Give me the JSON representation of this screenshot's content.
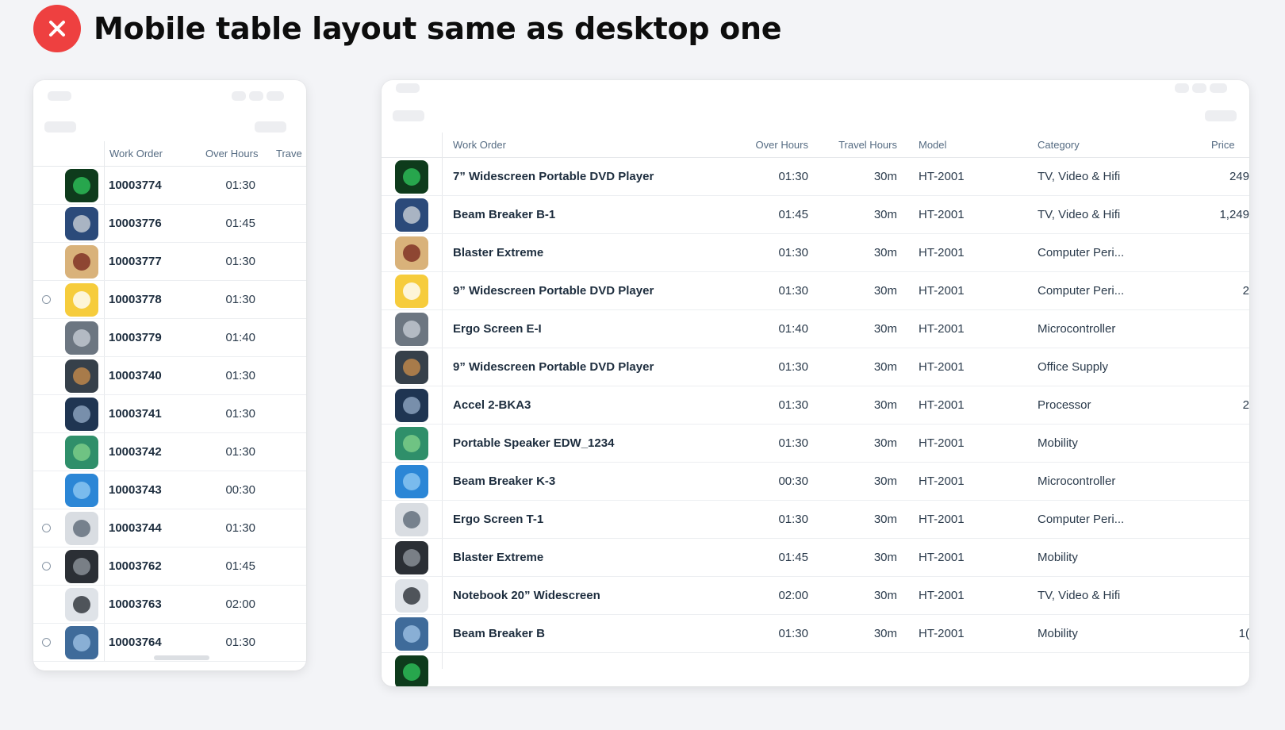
{
  "heading": {
    "title": "Mobile table layout same as desktop one",
    "badge_color": "#ee4040"
  },
  "mobile": {
    "columns": {
      "work_order": "Work Order",
      "over_hours": "Over Hours",
      "travel": "Trave"
    },
    "rows": [
      {
        "id": "10003774",
        "over": "01:30",
        "radio": false,
        "thumb": "matrix"
      },
      {
        "id": "10003776",
        "over": "01:45",
        "radio": false,
        "thumb": "disc"
      },
      {
        "id": "10003777",
        "over": "01:30",
        "radio": false,
        "thumb": "cup"
      },
      {
        "id": "10003778",
        "over": "01:30",
        "radio": true,
        "thumb": "yellow"
      },
      {
        "id": "10003779",
        "over": "01:40",
        "radio": false,
        "thumb": "grey"
      },
      {
        "id": "10003740",
        "over": "01:30",
        "radio": false,
        "thumb": "dark"
      },
      {
        "id": "10003741",
        "over": "01:30",
        "radio": false,
        "thumb": "machine"
      },
      {
        "id": "10003742",
        "over": "01:30",
        "radio": false,
        "thumb": "green"
      },
      {
        "id": "10003743",
        "over": "00:30",
        "radio": false,
        "thumb": "blue"
      },
      {
        "id": "10003744",
        "over": "01:30",
        "radio": true,
        "thumb": "server"
      },
      {
        "id": "10003762",
        "over": "01:45",
        "radio": true,
        "thumb": "fan"
      },
      {
        "id": "10003763",
        "over": "02:00",
        "radio": false,
        "thumb": "tool"
      },
      {
        "id": "10003764",
        "over": "01:30",
        "radio": true,
        "thumb": "city"
      }
    ]
  },
  "desktop": {
    "columns": {
      "work_order": "Work Order",
      "over_hours": "Over Hours",
      "travel_hours": "Travel Hours",
      "model": "Model",
      "category": "Category",
      "price": "Price"
    },
    "rows": [
      {
        "name": "7” Widescreen Portable DVD Player",
        "over": "01:30",
        "travel": "30m",
        "model": "HT-2001",
        "category": "TV, Video & Hifi",
        "price": "249",
        "thumb": "matrix"
      },
      {
        "name": "Beam Breaker B-1",
        "over": "01:45",
        "travel": "30m",
        "model": "HT-2001",
        "category": "TV, Video & Hifi",
        "price": "1,249",
        "thumb": "disc"
      },
      {
        "name": "Blaster Extreme",
        "over": "01:30",
        "travel": "30m",
        "model": "HT-2001",
        "category": "Computer Peri...",
        "price": "",
        "thumb": "cup"
      },
      {
        "name": "9” Widescreen Portable DVD Player",
        "over": "01:30",
        "travel": "30m",
        "model": "HT-2001",
        "category": "Computer Peri...",
        "price": "2",
        "thumb": "yellow"
      },
      {
        "name": "Ergo Screen E-I",
        "over": "01:40",
        "travel": "30m",
        "model": "HT-2001",
        "category": "Microcontroller",
        "price": "",
        "thumb": "grey"
      },
      {
        "name": "9” Widescreen Portable DVD Player",
        "over": "01:30",
        "travel": "30m",
        "model": "HT-2001",
        "category": "Office Supply",
        "price": "",
        "thumb": "dark"
      },
      {
        "name": "Accel 2-BKA3",
        "over": "01:30",
        "travel": "30m",
        "model": "HT-2001",
        "category": "Processor",
        "price": "2",
        "thumb": "machine"
      },
      {
        "name": "Portable Speaker EDW_1234",
        "over": "01:30",
        "travel": "30m",
        "model": "HT-2001",
        "category": "Mobility",
        "price": "",
        "thumb": "green"
      },
      {
        "name": "Beam Breaker K-3",
        "over": "00:30",
        "travel": "30m",
        "model": "HT-2001",
        "category": "Microcontroller",
        "price": "",
        "thumb": "blue"
      },
      {
        "name": "Ergo Screen T-1",
        "over": "01:30",
        "travel": "30m",
        "model": "HT-2001",
        "category": "Computer Peri...",
        "price": "",
        "thumb": "server"
      },
      {
        "name": "Blaster Extreme",
        "over": "01:45",
        "travel": "30m",
        "model": "HT-2001",
        "category": "Mobility",
        "price": "",
        "thumb": "fan"
      },
      {
        "name": "Notebook 20” Widescreen",
        "over": "02:00",
        "travel": "30m",
        "model": "HT-2001",
        "category": "TV, Video & Hifi",
        "price": "",
        "thumb": "tool"
      },
      {
        "name": "Beam Breaker B",
        "over": "01:30",
        "travel": "30m",
        "model": "HT-2001",
        "category": "Mobility",
        "price": "1(",
        "thumb": "city"
      }
    ]
  },
  "thumb_palette": {
    "matrix": [
      "#0e3b1c",
      "#2ec25a"
    ],
    "disc": [
      "#2b4a7a",
      "#c9ced6"
    ],
    "cup": [
      "#d9b27a",
      "#7a2a20"
    ],
    "yellow": [
      "#f6cc3c",
      "#ffffff"
    ],
    "grey": [
      "#6c7681",
      "#c6ccd3"
    ],
    "dark": [
      "#36404a",
      "#c58a4a"
    ],
    "machine": [
      "#1f3552",
      "#8fa6c2"
    ],
    "green": [
      "#2f8f6a",
      "#7fd08a"
    ],
    "blue": [
      "#2b86d6",
      "#8ec8f3"
    ],
    "server": [
      "#d9dde2",
      "#5d6a78"
    ],
    "fan": [
      "#2b2f35",
      "#8d939b"
    ],
    "tool": [
      "#dfe3e8",
      "#2a2f36"
    ],
    "city": [
      "#3f6b9a",
      "#9cc1e4"
    ]
  }
}
